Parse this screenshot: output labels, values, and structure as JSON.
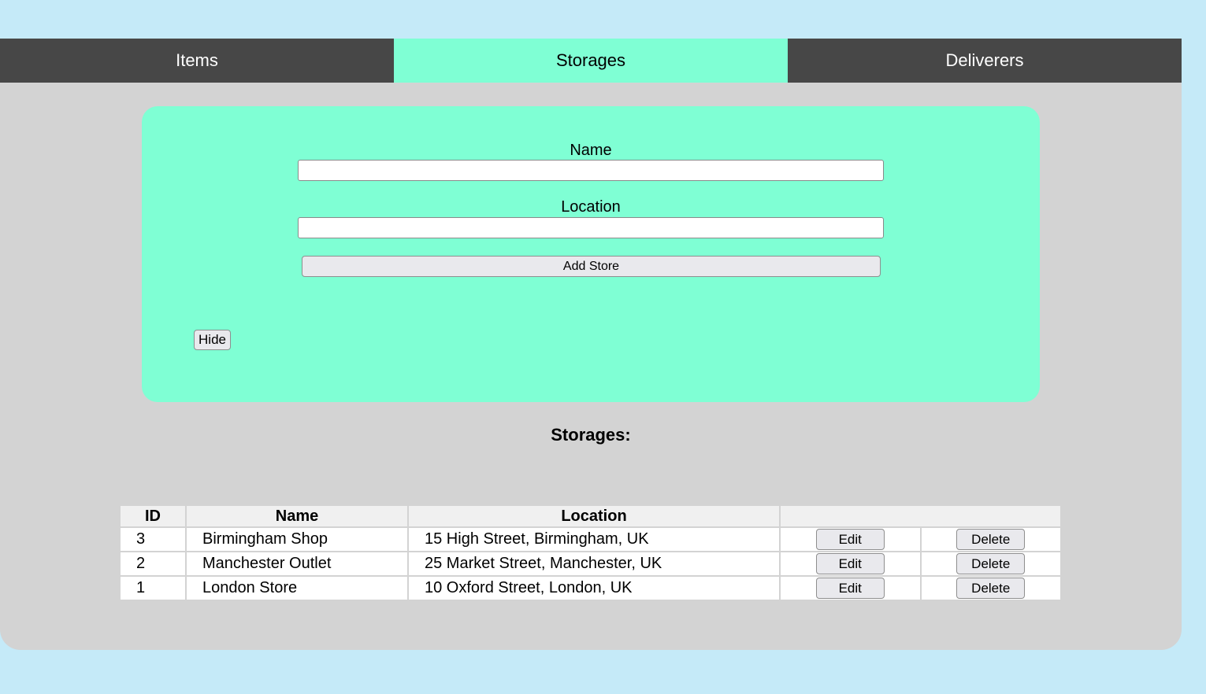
{
  "tabs": [
    {
      "label": "Items",
      "active": false
    },
    {
      "label": "Storages",
      "active": true
    },
    {
      "label": "Deliverers",
      "active": false
    }
  ],
  "form": {
    "name_label": "Name",
    "name_value": "",
    "location_label": "Location",
    "location_value": "",
    "add_button": "Add Store",
    "hide_button": "Hide"
  },
  "list": {
    "title": "Storages:",
    "columns": [
      "ID",
      "Name",
      "Location",
      ""
    ],
    "rows": [
      {
        "id": "3",
        "name": "Birmingham Shop",
        "location": "15 High Street, Birmingham, UK",
        "edit": "Edit",
        "delete": "Delete"
      },
      {
        "id": "2",
        "name": "Manchester Outlet",
        "location": "25 Market Street, Manchester, UK",
        "edit": "Edit",
        "delete": "Delete"
      },
      {
        "id": "1",
        "name": "London Store",
        "location": "10 Oxford Street, London, UK",
        "edit": "Edit",
        "delete": "Delete"
      }
    ]
  },
  "colors": {
    "page_bg": "#c5eaf8",
    "content_bg": "#d3d3d3",
    "tab_bg": "#474747",
    "accent": "#7fffd4"
  }
}
